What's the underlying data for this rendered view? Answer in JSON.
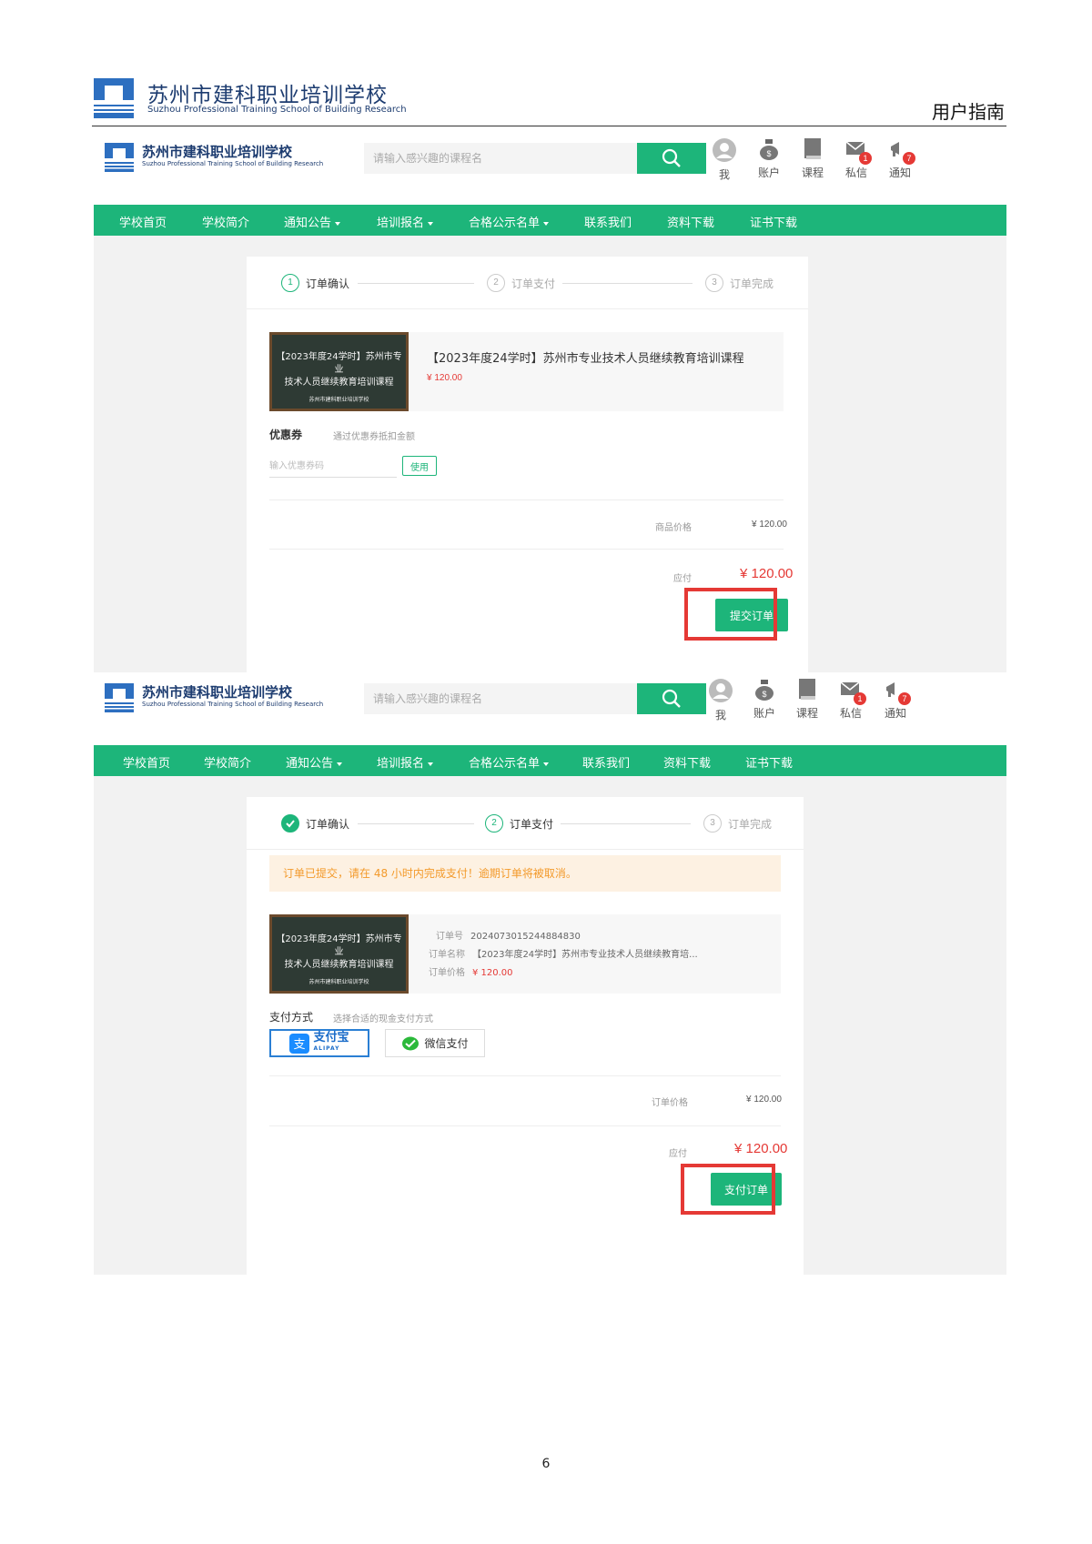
{
  "document": {
    "school_name_zh": "苏州市建科职业培训学校",
    "school_name_en": "Suzhou Professional Training School of Building Research",
    "guide_title": "用户指南",
    "page_number": "6"
  },
  "site": {
    "logo_zh": "苏州市建科职业培训学校",
    "logo_en": "Suzhou Professional Training School of Building Research",
    "search_placeholder": "请输入感兴趣的课程名",
    "header_icons": [
      {
        "label": "我",
        "icon": "user-icon"
      },
      {
        "label": "账户",
        "icon": "money-bag-icon"
      },
      {
        "label": "课程",
        "icon": "book-icon"
      },
      {
        "label": "私信",
        "icon": "mail-icon",
        "badge": "1"
      },
      {
        "label": "通知",
        "icon": "megaphone-icon",
        "badge": "7"
      }
    ],
    "nav": [
      "学校首页",
      "学校简介",
      "通知公告",
      "培训报名",
      "合格公示名单",
      "联系我们",
      "资料下载",
      "证书下载"
    ],
    "brand_color": "#1db57a",
    "alert_color": "#e53935"
  },
  "steps": [
    "订单确认",
    "订单支付",
    "订单完成"
  ],
  "course": {
    "thumb_line1": "【2023年度24学时】苏州市专业",
    "thumb_line2": "技术人员继续教育培训课程",
    "thumb_line3": "苏州市建科职业培训学校",
    "title": "【2023年度24学时】苏州市专业技术人员继续教育培训课程",
    "price": "¥ 120.00"
  },
  "confirm": {
    "coupon_title": "优惠券",
    "coupon_note": "通过优惠券抵扣金额",
    "coupon_placeholder": "输入优惠券码",
    "coupon_button": "使用",
    "goods_price_label": "商品价格",
    "goods_price": "¥ 120.00",
    "due_label": "应付",
    "due_amount": "¥ 120.00",
    "submit_button": "提交订单"
  },
  "payment": {
    "notice": "订单已提交，请在 48 小时内完成支付！逾期订单将被取消。",
    "order_no_label": "订单号",
    "order_no": "2024073015244884830",
    "order_name_label": "订单名称",
    "order_name": "【2023年度24学时】苏州市专业技术人员继续教育培...",
    "order_price_label": "订单价格",
    "order_price": "¥ 120.00",
    "method_title": "支付方式",
    "method_note": "选择合适的现金支付方式",
    "alipay_label": "支付宝",
    "alipay_sub": "ALIPAY",
    "wechat_label": "微信支付",
    "total_label": "订单价格",
    "total": "¥ 120.00",
    "due_label": "应付",
    "due_amount": "¥ 120.00",
    "pay_button": "支付订单"
  }
}
